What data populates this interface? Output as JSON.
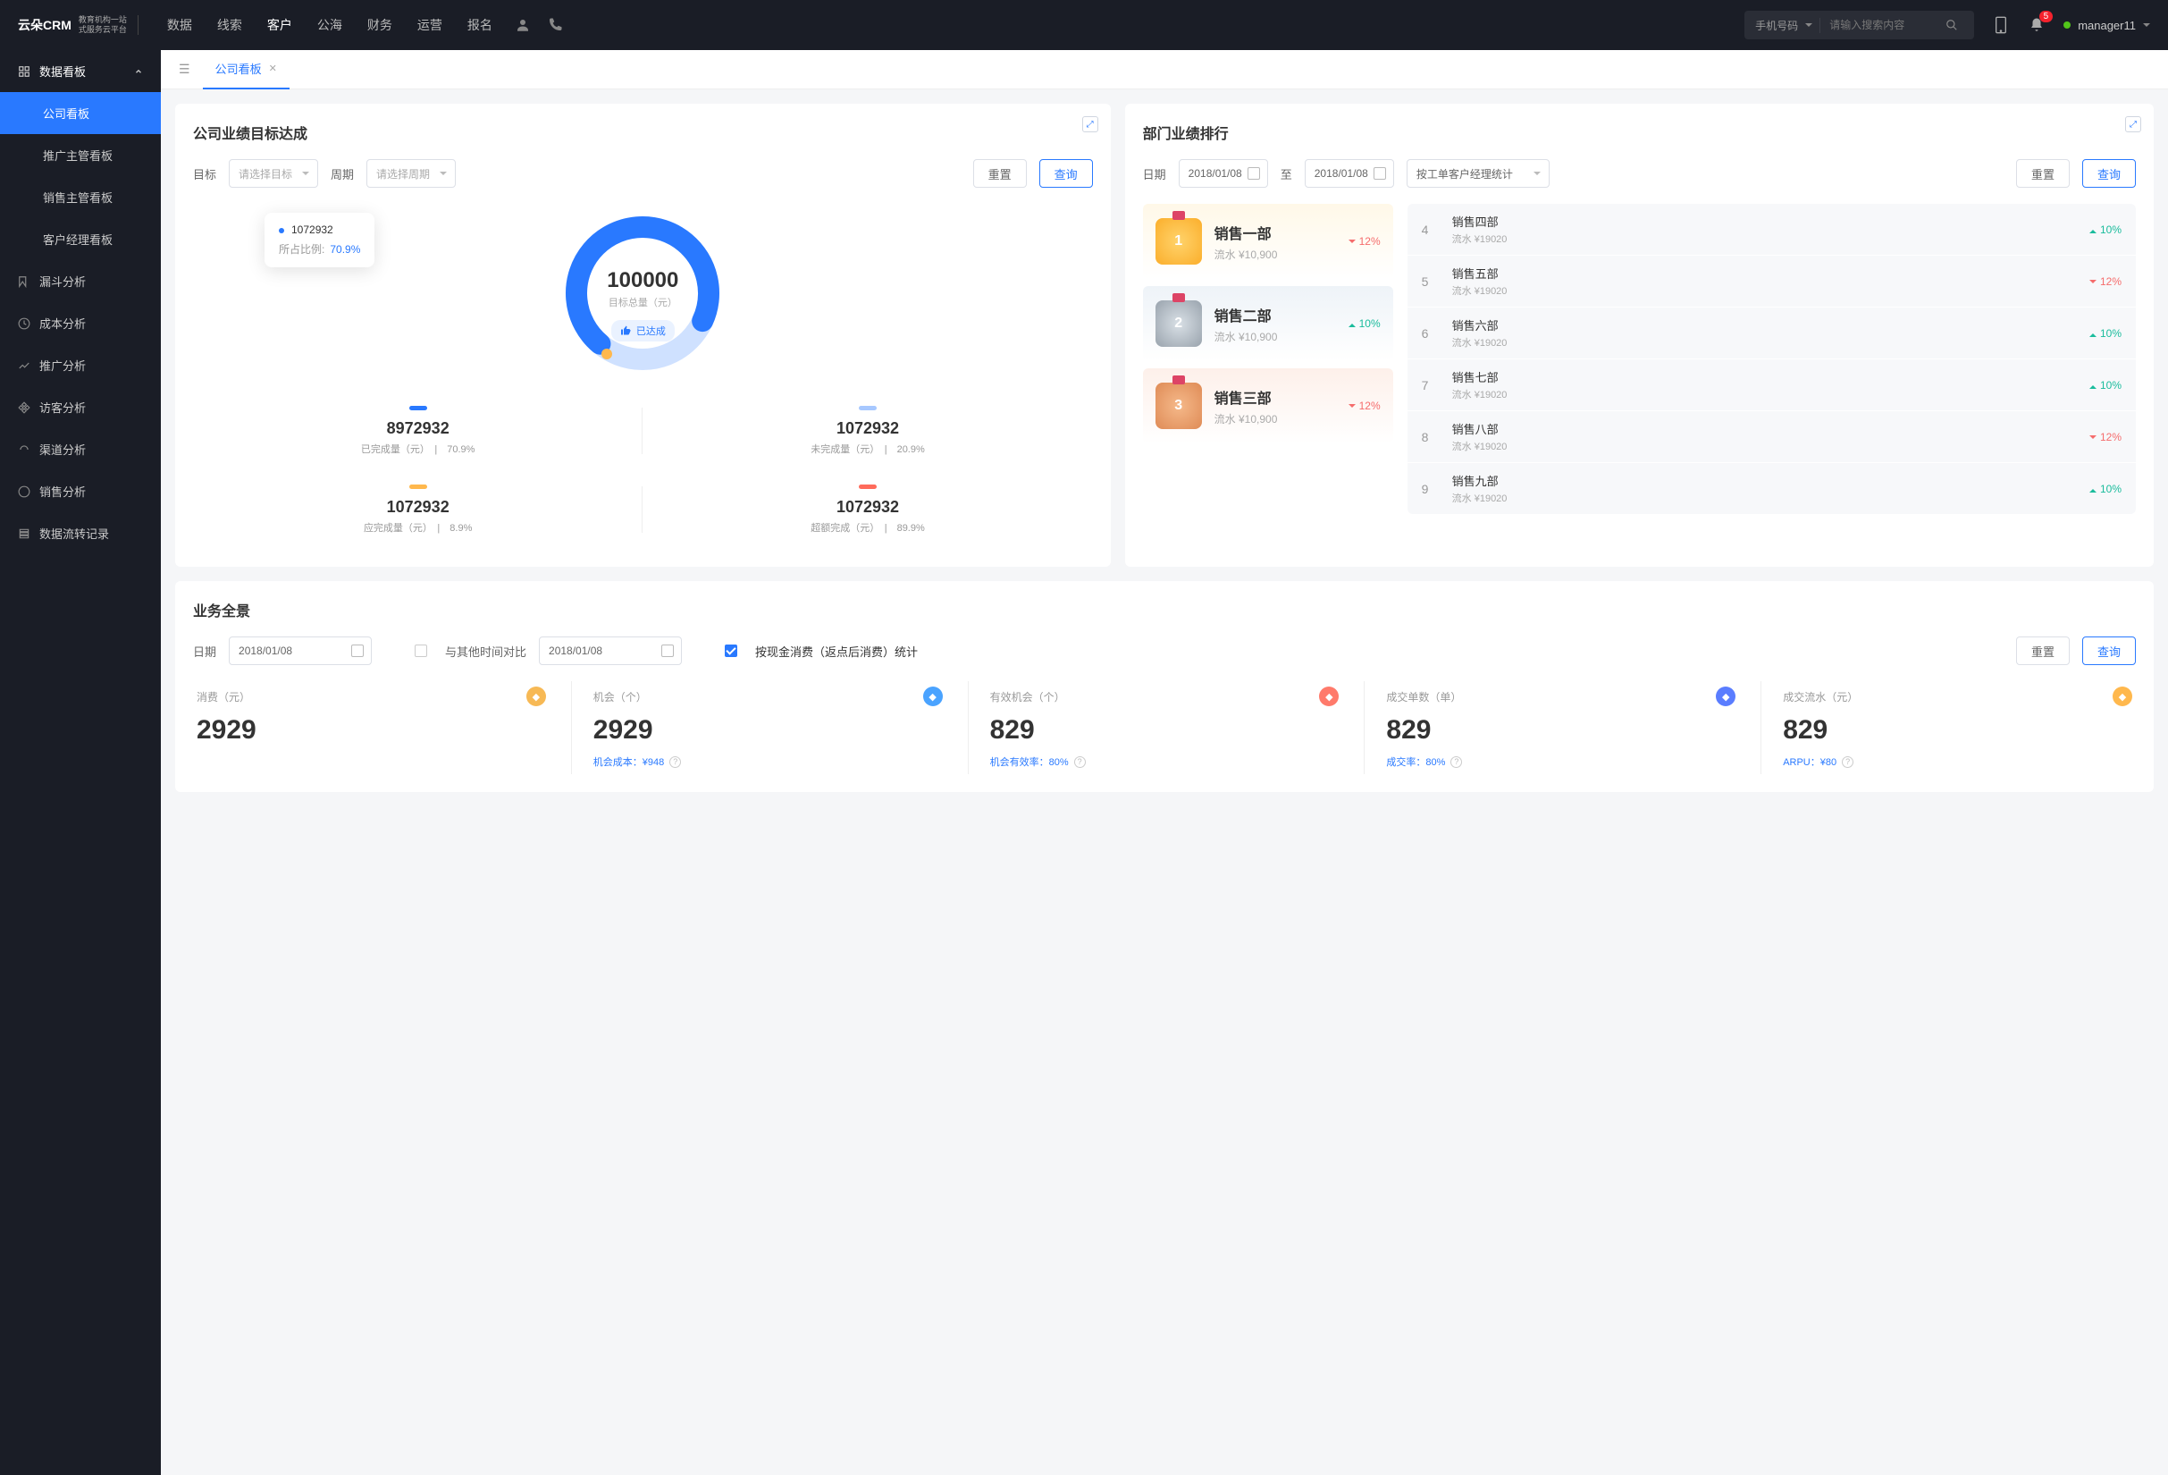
{
  "brand": {
    "main": "云朵CRM",
    "sub1": "教育机构一站",
    "sub2": "式服务云平台"
  },
  "topnav": [
    "数据",
    "线索",
    "客户",
    "公海",
    "财务",
    "运营",
    "报名"
  ],
  "topnav_active": 2,
  "search": {
    "type": "手机号码",
    "placeholder": "请输入搜索内容"
  },
  "notif_count": "5",
  "user": "manager11",
  "sidebar": {
    "group": "数据看板",
    "children": [
      "公司看板",
      "推广主管看板",
      "销售主管看板",
      "客户经理看板"
    ],
    "active_child": 0,
    "items": [
      "漏斗分析",
      "成本分析",
      "推广分析",
      "访客分析",
      "渠道分析",
      "销售分析",
      "数据流转记录"
    ]
  },
  "tab": {
    "label": "公司看板"
  },
  "card1": {
    "title": "公司业绩目标达成",
    "target_label": "目标",
    "target_ph": "请选择目标",
    "period_label": "周期",
    "period_ph": "请选择周期",
    "reset": "重置",
    "query": "查询",
    "tooltip_value": "1072932",
    "tooltip_ratio_label": "所占比例:",
    "tooltip_ratio": "70.9%",
    "center_num": "100000",
    "center_label": "目标总量（元）",
    "reached": "已达成",
    "stats": [
      {
        "bar": "#2979ff",
        "num": "8972932",
        "label": "已完成量（元）",
        "pct": "70.9%"
      },
      {
        "bar": "#a7c8ff",
        "num": "1072932",
        "label": "未完成量（元）",
        "pct": "20.9%"
      },
      {
        "bar": "#ffb84d",
        "num": "1072932",
        "label": "应完成量（元）",
        "pct": "8.9%"
      },
      {
        "bar": "#ff6b5b",
        "num": "1072932",
        "label": "超额完成（元）",
        "pct": "89.9%"
      }
    ]
  },
  "card2": {
    "title": "部门业绩排行",
    "date_label": "日期",
    "date_from": "2018/01/08",
    "date_to_label": "至",
    "date_to": "2018/01/08",
    "group_by": "按工单客户经理统计",
    "reset": "重置",
    "query": "查询",
    "top3": [
      {
        "name": "销售一部",
        "sub": "流水 ¥10,900",
        "pct": "12%",
        "dir": "down",
        "cls": "rank-gold",
        "medal": "medal-gold",
        "no": "1"
      },
      {
        "name": "销售二部",
        "sub": "流水 ¥10,900",
        "pct": "10%",
        "dir": "up",
        "cls": "rank-silver",
        "medal": "medal-silver",
        "no": "2"
      },
      {
        "name": "销售三部",
        "sub": "流水 ¥10,900",
        "pct": "12%",
        "dir": "down",
        "cls": "rank-bronze",
        "medal": "medal-bronze",
        "no": "3"
      }
    ],
    "rest": [
      {
        "no": "4",
        "name": "销售四部",
        "sub": "流水 ¥19020",
        "pct": "10%",
        "dir": "up"
      },
      {
        "no": "5",
        "name": "销售五部",
        "sub": "流水 ¥19020",
        "pct": "12%",
        "dir": "down"
      },
      {
        "no": "6",
        "name": "销售六部",
        "sub": "流水 ¥19020",
        "pct": "10%",
        "dir": "up"
      },
      {
        "no": "7",
        "name": "销售七部",
        "sub": "流水 ¥19020",
        "pct": "10%",
        "dir": "up"
      },
      {
        "no": "8",
        "name": "销售八部",
        "sub": "流水 ¥19020",
        "pct": "12%",
        "dir": "down"
      },
      {
        "no": "9",
        "name": "销售九部",
        "sub": "流水 ¥19020",
        "pct": "10%",
        "dir": "up"
      }
    ]
  },
  "card3": {
    "title": "业务全景",
    "date_label": "日期",
    "date": "2018/01/08",
    "compare_label": "与其他时间对比",
    "compare_date": "2018/01/08",
    "cash_label": "按现金消费（返点后消费）统计",
    "reset": "重置",
    "query": "查询",
    "cells": [
      {
        "label": "消费（元）",
        "num": "2929",
        "icon": "#f7b955",
        "sub": ""
      },
      {
        "label": "机会（个）",
        "num": "2929",
        "icon": "#4aa3ff",
        "sub": "机会成本：¥948"
      },
      {
        "label": "有效机会（个）",
        "num": "829",
        "icon": "#ff7a6b",
        "sub": "机会有效率：80%"
      },
      {
        "label": "成交单数（单）",
        "num": "829",
        "icon": "#5a7dff",
        "sub": "成交率：80%"
      },
      {
        "label": "成交流水（元）",
        "num": "829",
        "icon": "#ffb84d",
        "sub": "ARPU：¥80"
      }
    ]
  },
  "chart_data": {
    "type": "pie",
    "title": "目标总量（元）",
    "total": 100000,
    "series": [
      {
        "name": "已完成量",
        "value": 8972932,
        "pct": 70.9,
        "color": "#2979ff"
      },
      {
        "name": "未完成量",
        "value": 1072932,
        "pct": 20.9,
        "color": "#a7c8ff"
      }
    ],
    "extra": [
      {
        "name": "应完成量",
        "value": 1072932,
        "pct": 8.9
      },
      {
        "name": "超额完成",
        "value": 1072932,
        "pct": 89.9
      }
    ]
  }
}
